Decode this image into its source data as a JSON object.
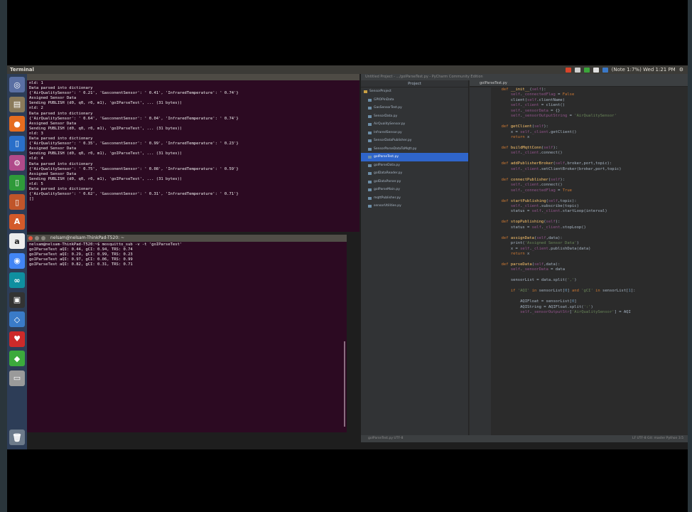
{
  "topbar": {
    "title": "Terminal",
    "tray_text": "(Note 1:7%) Wed 1:21 PM"
  },
  "launcher": {
    "icons": [
      "ubuntu-dash",
      "files",
      "firefox",
      "libreoffice-writer",
      "settings",
      "libreoffice-calc",
      "libreoffice-impress",
      "software-center",
      "amazon",
      "chromium",
      "arduino",
      "terminal",
      "vscode",
      "app-red",
      "app-green",
      "disk"
    ],
    "colors": [
      "#5a6fa3",
      "#8a7a5a",
      "#e66d1f",
      "#2a6fc9",
      "#b04a8a",
      "#2f9a3a",
      "#c0552a",
      "#d35a2a",
      "#ececec",
      "#4285f4",
      "#0f8fa0",
      "#333333",
      "#3a7bc8",
      "#cc2a2a",
      "#3caa3c",
      "#9a9a9a"
    ],
    "glyphs": [
      "◎",
      "▤",
      "●",
      "▯",
      "⚙",
      "▯",
      "▯",
      "A",
      "a",
      "◉",
      "∞",
      "▣",
      "◇",
      "♥",
      "◆",
      "▭"
    ],
    "trash": "trash-icon"
  },
  "terminal1": {
    "lines": [
      "nld: 1",
      "Data parsed into dictionary",
      "{'AirQualitySensor': ' 0.21', 'GasconentSensor': ' 0.41', 'InfraredTemperature': ' 0.74'}",
      "Assigned Sensor Data",
      "Sending PUBLISH (d0, q0, r0, m1), 'goIParseTest', ... (31 bytes))",
      "nld: 2",
      "Data parsed into dictionary",
      "{'AirQualitySensor': ' 0.64', 'GasconentSensor': ' 0.04', 'InfraredTemperature': ' 0.74'}",
      "Assigned Sensor Data",
      "Sending PUBLISH (d0, q0, r0, m1), 'goIParseTest', ... (31 bytes))",
      "nld: 3",
      "Data parsed into dictionary",
      "{'AirQualitySensor': ' 0.35', 'GasconentSensor': ' 0.99', 'InfraredTemperature': ' 0.23'}",
      "Assigned Sensor Data",
      "Sending PUBLISH (d0, q0, r0, m1), 'goIParseTest', ... (31 bytes))",
      "nld: 4",
      "Data parsed into dictionary",
      "{'AirQualitySensor': ' 0.75', 'GasconentSensor': ' 0.08', 'InfraredTemperature': ' 0.59'}",
      "Assigned Sensor Data",
      "Sending PUBLISH (d0, q0, r0, m1), 'goIParseTest', ... (31 bytes))",
      "nld: 5",
      "Data parsed into dictionary",
      "{'AirQualitySensor': ' 0.62', 'GasconentSensor': ' 0.31', 'InfraredTemperature': ' 0.71'}",
      "[]"
    ]
  },
  "terminal2": {
    "title": "nelsam@nelsam-ThinkPad-T520: ~",
    "lines": [
      "nelsam@nelsam-ThinkPad-T520:~$ mosquitto_sub -v -t 'goIParseTest'",
      "goIParseTest aQI: 0.44, gCI: 0.94, TRS: 0.74",
      "goIParseTest aQI: 0.29, gCI: 0.99, TRS: 0.23",
      "goIParseTest aQI: 0.97, gCI: 0.06, TRS: 0.99",
      "goIParseTest aQI: 0.82, gCI: 0.31, TRS: 0.71"
    ]
  },
  "ide": {
    "tabs_text": "Untitled Project - .../goIParseTest.py - PyCharm Community Edition",
    "project_header": "Project",
    "files": [
      "SensorProject",
      "GPIOPinData",
      "GasSensorTest.py",
      "SensorData.py",
      "AirQualitySensor.py",
      "InfraredSensor.py",
      "SensorDataPublisher.py",
      "SensorParseDataToMqtt.py",
      "goIParseTest.py",
      "goIParseData.py",
      "goIDataReader.py",
      "goIDataParser.py",
      "goIParseMain.py",
      "mqttPublisher.py",
      "sensorUtilities.py"
    ],
    "selected_file_index": 8,
    "editor_tab": "goIParseTest.py",
    "status_left": "goIParseTest.py   UTF-8",
    "status_right": "LF   UTF-8   Git: master   Python 3.5"
  }
}
